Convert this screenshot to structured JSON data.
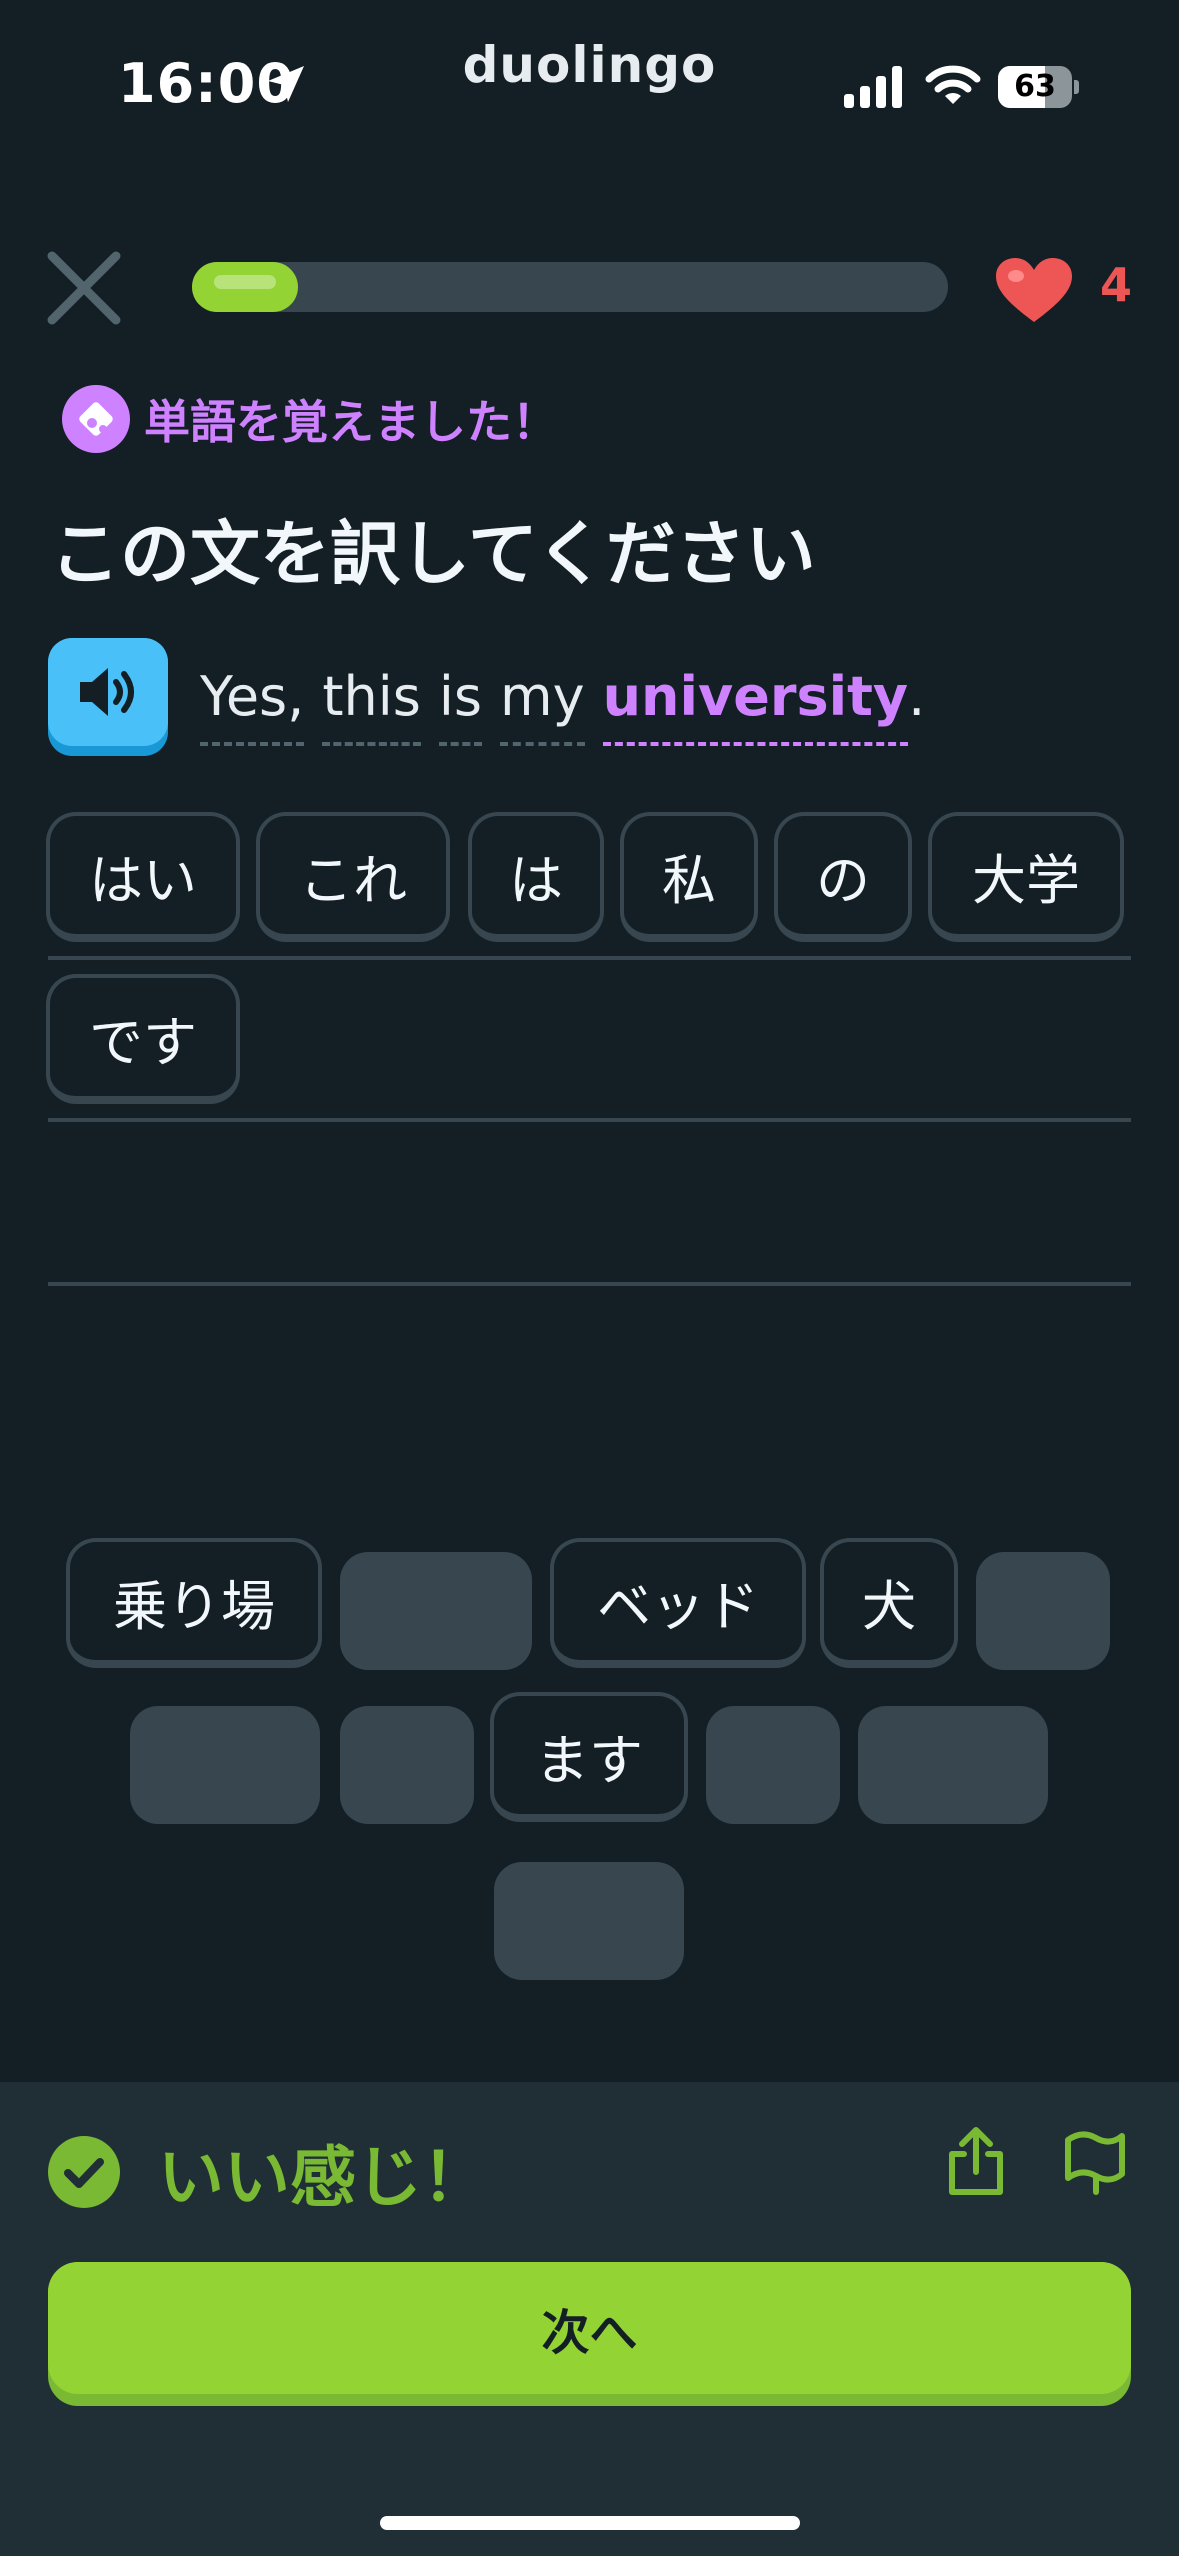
{
  "status_bar": {
    "time": "16:00",
    "app_name": "duolingo",
    "battery": 63
  },
  "header": {
    "progress": 0.14,
    "hearts": "4"
  },
  "badge": {
    "text": "単語を覚えました！"
  },
  "instruction": "この文を訳してください",
  "prompt": {
    "words": [
      "Yes,",
      "this",
      "is",
      "my"
    ],
    "highlight_word": "university",
    "trailing": "."
  },
  "answer_tiles": [
    "はい",
    "これ",
    "は",
    "私",
    "の",
    "大学",
    "です"
  ],
  "word_bank": [
    "乗り場",
    "ベッド",
    "犬",
    "ます"
  ],
  "feedback": {
    "title": "いい感じ！",
    "next_label": "次へ"
  },
  "colors": {
    "background": "#131f24",
    "accent_green": "#93d333",
    "feedback_green": "#79b933",
    "highlight_purple": "#ce82ff",
    "heart_red": "#ee5555",
    "speaker_blue": "#49c0f8"
  }
}
